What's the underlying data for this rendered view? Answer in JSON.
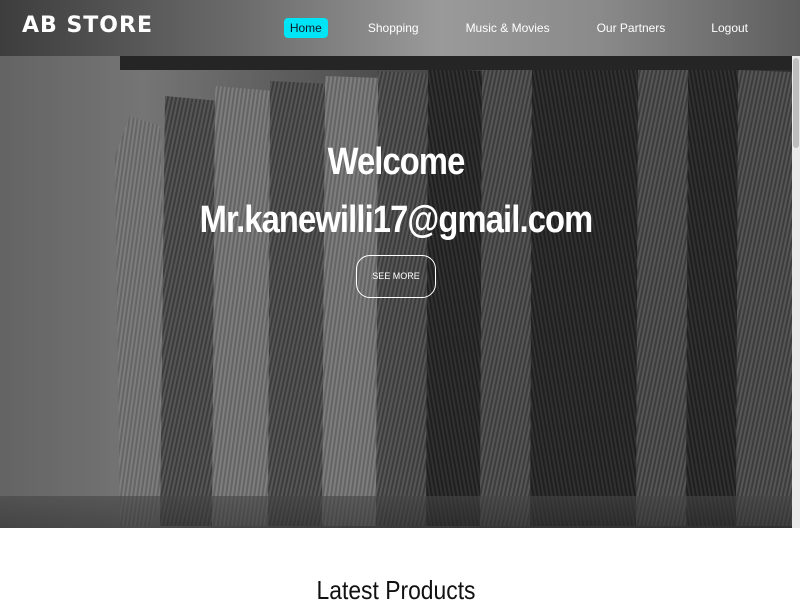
{
  "header": {
    "brand": "AB STORE",
    "nav": [
      {
        "label": "Home",
        "active": true
      },
      {
        "label": "Shopping",
        "active": false
      },
      {
        "label": "Music & Movies",
        "active": false
      },
      {
        "label": "Our Partners",
        "active": false
      },
      {
        "label": "Logout",
        "active": false
      }
    ]
  },
  "hero": {
    "title": "Welcome",
    "email": "Mr.kanewilli17@gmail.com",
    "button_label": "SEE MORE",
    "background_icon": "clothing-rack-photo"
  },
  "main": {
    "section_title": "Latest Products"
  },
  "colors": {
    "accent": "#00e5f5",
    "hero_text": "#ffffff",
    "page_background": "#ffffff"
  }
}
